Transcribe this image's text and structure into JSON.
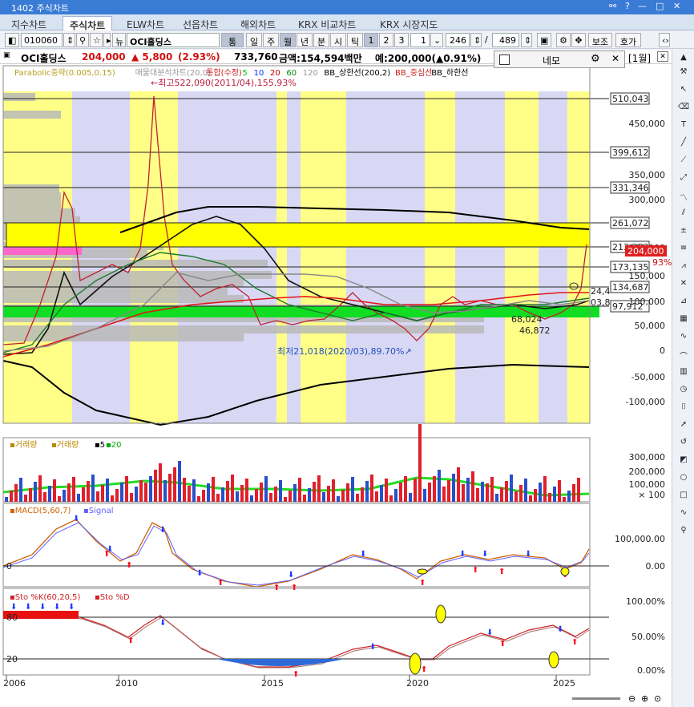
{
  "window": {
    "title": "1402 주식차트",
    "controls": [
      "?",
      "—",
      "□",
      "✕"
    ]
  },
  "tabs": [
    "지수차트",
    "주식차트",
    "ELW차트",
    "선옵차트",
    "해외차트",
    "KRX 비교차트",
    "KRX 시장지도"
  ],
  "active_tab": "주식차트",
  "toolbar": {
    "code": "010060",
    "name": "OCI홀딩스",
    "integrated": "통합",
    "periods": [
      "일",
      "주",
      "월",
      "년",
      "분",
      "시",
      "틱"
    ],
    "active_period": "월",
    "nums": [
      "1",
      "2",
      "3"
    ],
    "active_num": "1",
    "count": "1",
    "bars_shown": "246",
    "bars_total": "489",
    "aux": "보조",
    "call": "호가"
  },
  "info": {
    "name": "OCI홀딩스",
    "price": "204,000",
    "change": "▲ 5,800",
    "pct": "(2.93%)",
    "volume": "733,760",
    "amount": "금액:154,594백만",
    "expected": "예:200,000(▲0.91%)",
    "period_badge": "[1월]"
  },
  "popup": {
    "label": "네모"
  },
  "price_panel": {
    "legend": [
      "Parabolic중략(0.005,0.15)",
      "매물대분석차트(20,0)",
      "통합(수정)",
      "5",
      "10",
      "20",
      "60",
      "120",
      "BB_상한선(200,2)",
      "BB_중심선",
      "BB_하한선"
    ],
    "y_ticks": [
      "510,043",
      "450,000",
      "399,612",
      "350,000",
      "331,346",
      "300,000",
      "261,072",
      "213,253",
      "200,000",
      "173,135",
      "150,000",
      "134,687",
      "100,000",
      "97,912",
      "50,000",
      "0",
      "-50,000",
      "-100,000"
    ],
    "hlines": [
      "510,043",
      "399,612",
      "331,346",
      "261,072",
      "213,253",
      "173,135",
      "134,687",
      "97,912"
    ],
    "annotations": {
      "high": "최고522,090(2011/04),155.93%",
      "low": "최저21,018(2020/03),89.70%",
      "mid1": "68,024",
      "mid2": "46,872",
      "right1": "24,4",
      "right2": "03,8",
      "pct_right": "93%"
    }
  },
  "volume_panel": {
    "legend": [
      "거래량",
      "거래량",
      "5",
      "20"
    ],
    "y_ticks": [
      "300,000",
      "200,000",
      "100,000",
      "× 100"
    ]
  },
  "macd_panel": {
    "legend": [
      "MACD(5,60,7)",
      "Signal"
    ],
    "y_ticks": [
      "100,000.00",
      "0.00"
    ],
    "zero_label": "0"
  },
  "stoch_panel": {
    "legend": [
      "Sto %K(60,20,5)",
      "Sto %D"
    ],
    "y_ticks": [
      "100.00%",
      "50.00%",
      "0.00%"
    ],
    "levels": [
      "80",
      "20"
    ]
  },
  "x_axis": [
    "2006",
    "2010",
    "2015",
    "2020",
    "2025"
  ],
  "colors": {
    "accent": "#3a7bd5",
    "up": "#e0202a",
    "down": "#2850c8",
    "band_yellow": "#ffff88",
    "band_lavender": "#d8d8f4",
    "ma5": "#00cc00",
    "volume_line": "#22dd22"
  }
}
